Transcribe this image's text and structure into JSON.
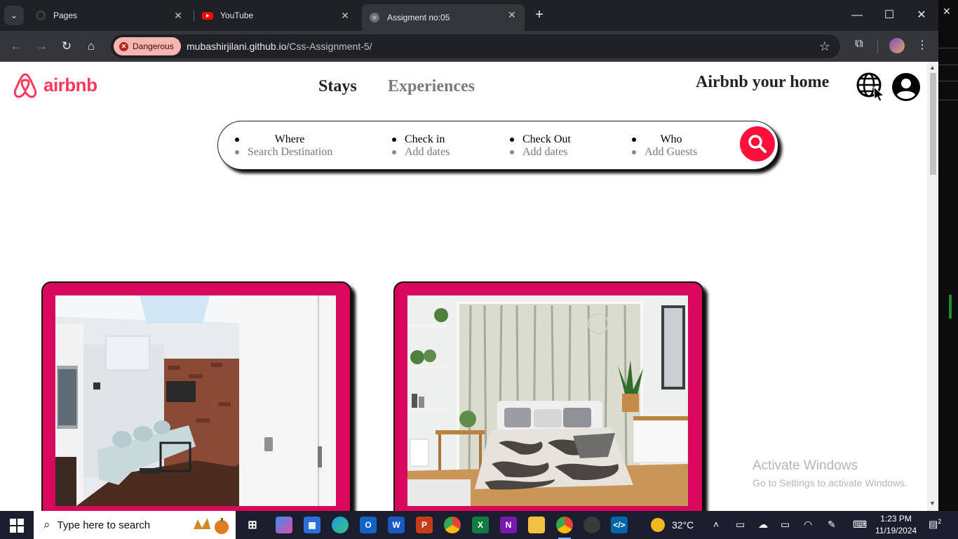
{
  "browser": {
    "tabs": [
      {
        "title": "Pages"
      },
      {
        "title": "YouTube"
      },
      {
        "title": "Assigment no:05"
      }
    ],
    "security_label": "Dangerous",
    "url_host": "mubashirjilani.github.io",
    "url_path": "/Css-Assignment-5/"
  },
  "site": {
    "logo_text": "airbnb",
    "nav": {
      "stays": "Stays",
      "experiences": "Experiences"
    },
    "host_link": "Airbnb your home",
    "search": {
      "where": {
        "label": "Where",
        "sub": "Search Destination"
      },
      "checkin": {
        "label": "Check in",
        "sub": "Add dates"
      },
      "checkout": {
        "label": "Check Out",
        "sub": "Add dates"
      },
      "who": {
        "label": "Who",
        "sub": "Add Guests"
      }
    }
  },
  "watermark": {
    "line1": "Activate Windows",
    "line2": "Go to Settings to activate Windows."
  },
  "taskbar": {
    "search_placeholder": "Type here to search",
    "weather": "32°C",
    "time": "1:23 PM",
    "date": "11/19/2024",
    "notifications": "2"
  },
  "colors": {
    "brand": "#ff385c",
    "card_frame": "#d8085c",
    "search_button": "#ff0f3a"
  }
}
